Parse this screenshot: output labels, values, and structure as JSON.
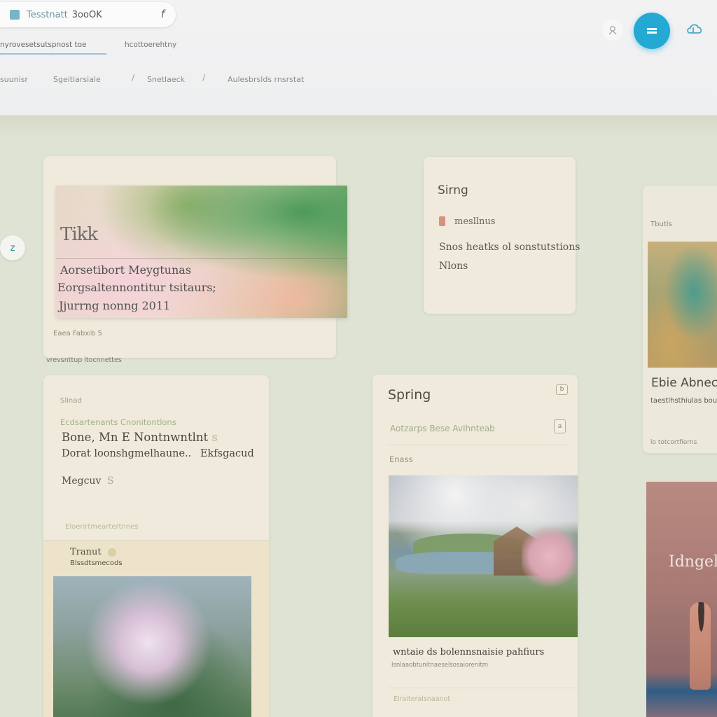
{
  "header": {
    "app_title": "Tesstnatt",
    "app_title_tail": "3ooOK",
    "search_caret": "f",
    "subtabs": [
      "nyrovesetsutspnost toe",
      "hcottoerehtny"
    ],
    "nav_links": [
      "suunisr",
      "Sgeitiarsiale",
      "Snetlaeck",
      "Aulesbrslds rnsrstat"
    ]
  },
  "colors": {
    "accent": "#23a9d3",
    "page_bg": "#dfe3d4",
    "card_bg": "#efeadb"
  },
  "side_button": {
    "label": "z"
  },
  "cards": {
    "a": {
      "hero_title": "Tikk",
      "lines": [
        "Aorsetibort Meygtunas",
        "Eorgsaltennontitur tsitaurs;",
        "Jjurrng nonng 2011"
      ],
      "meta": "Eaea Fabxib 5",
      "footer": "vrevsnttup ltocnnettes"
    },
    "b": {
      "title": "Sirng",
      "label": "mesllnus",
      "lines": [
        "Snos heatks ol sonstutstions",
        "Nlons"
      ]
    },
    "c": {
      "label": "Tbutls",
      "title": "Ebie Abnech",
      "subtitle": "taestlhsthiulas bouos",
      "footer": "lo totcortfierns"
    },
    "f": {
      "title": "Idngel"
    },
    "d": {
      "label": "Slinad",
      "subtitle": "Ecdsartenants Cnonitontlons",
      "title_line1": "Bone, Mn E Nontnwntlnt",
      "title_line1_tail": "s",
      "title_line2": "Dorat loonshgmelhaune..",
      "title_line2_tail": "Ekfsgacud",
      "tag": "Megcuv",
      "tag_tail": "S",
      "footer": "Eloerirtmeartertnnes",
      "lower_title": "Tranut",
      "lower_subtitle": "Blssdtsmecods"
    },
    "e": {
      "title": "Spring",
      "subtitle": "Aotzarps Bese AvIhnteab",
      "label": "Enass",
      "caption": "wntaie ds bolennsnaisie pahfiurs",
      "caption_sub": "Isnlaaobtunitnaeselsosaiorenitm",
      "footer": "Elraiteralsnaanot"
    }
  }
}
